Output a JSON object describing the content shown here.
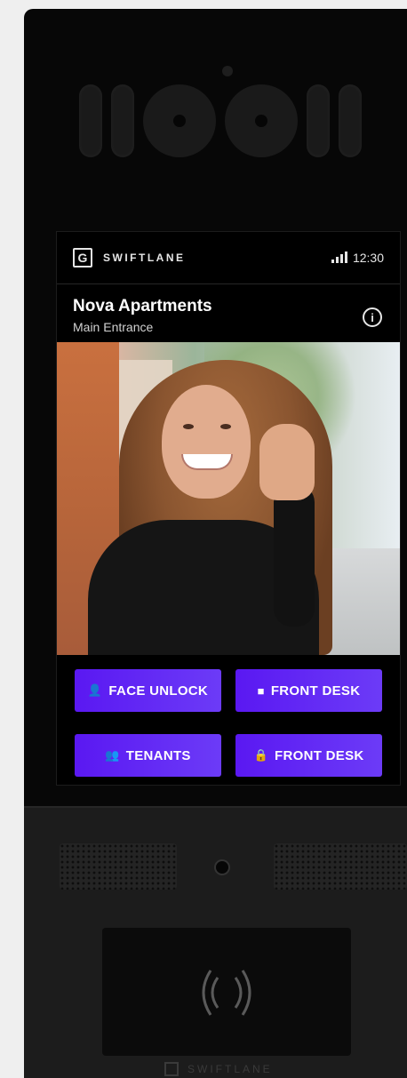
{
  "status_bar": {
    "brand": "SWIFTLANE",
    "brand_logo": "G",
    "time": "12:30",
    "signal_icon": "signal-icon"
  },
  "location": {
    "title": "Nova Apartments",
    "subtitle": "Main Entrance",
    "info_icon": "i"
  },
  "actions": [
    {
      "label": "FACE UNLOCK",
      "icon": "person-icon",
      "glyph": "👤"
    },
    {
      "label": "FRONT DESK",
      "icon": "video-icon",
      "glyph": "■"
    },
    {
      "label": "TENANTS",
      "icon": "group-icon",
      "glyph": "👥"
    },
    {
      "label": "FRONT DESK",
      "icon": "lock-icon",
      "glyph": "🔒"
    }
  ],
  "hardware": {
    "bottom_brand": "SWIFTLANE"
  },
  "colors": {
    "button_gradient_start": "#5a18f2",
    "button_gradient_end": "#6c3bf7",
    "device_body": "#070707",
    "page_bg": "#efefef"
  }
}
